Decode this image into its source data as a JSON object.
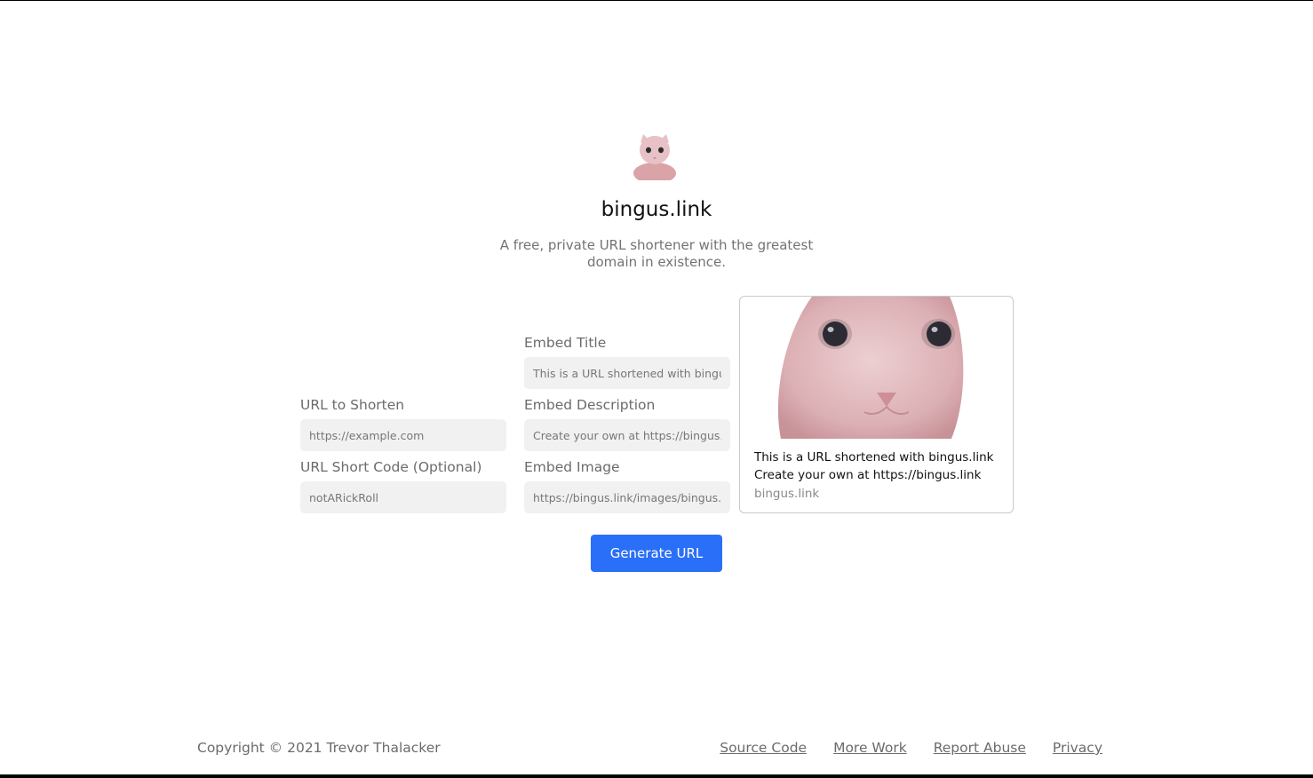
{
  "header": {
    "logo_icon": "pink-cat-icon",
    "title": "bingus.link",
    "tagline": "A free, private URL shortener with the greatest domain in existence."
  },
  "form": {
    "url_to_shorten": {
      "label": "URL to Shorten",
      "placeholder": "https://example.com",
      "value": ""
    },
    "short_code": {
      "label": "URL Short Code (Optional)",
      "placeholder": "notARickRoll",
      "value": ""
    },
    "embed_title": {
      "label": "Embed Title",
      "placeholder": "This is a URL shortened with bingus.link",
      "value": ""
    },
    "embed_description": {
      "label": "Embed Description",
      "placeholder": "Create your own at https://bingus.link",
      "value": ""
    },
    "embed_image": {
      "label": "Embed Image",
      "placeholder": "https://bingus.link/images/bingus.png",
      "value": ""
    },
    "generate_label": "Generate URL"
  },
  "preview": {
    "title": "This is a URL shortened with bingus.link",
    "description": "Create your own at https://bingus.link",
    "domain": "bingus.link"
  },
  "footer": {
    "copyright": "Copyright © 2021 Trevor Thalacker",
    "links": [
      {
        "label": "Source Code"
      },
      {
        "label": "More Work"
      },
      {
        "label": "Report Abuse"
      },
      {
        "label": "Privacy"
      }
    ]
  },
  "colors": {
    "accent": "#2a6ff7",
    "input_bg": "#f1f1f1",
    "muted_text": "#6b6b6b",
    "cat_pink": "#e6bcc0"
  }
}
